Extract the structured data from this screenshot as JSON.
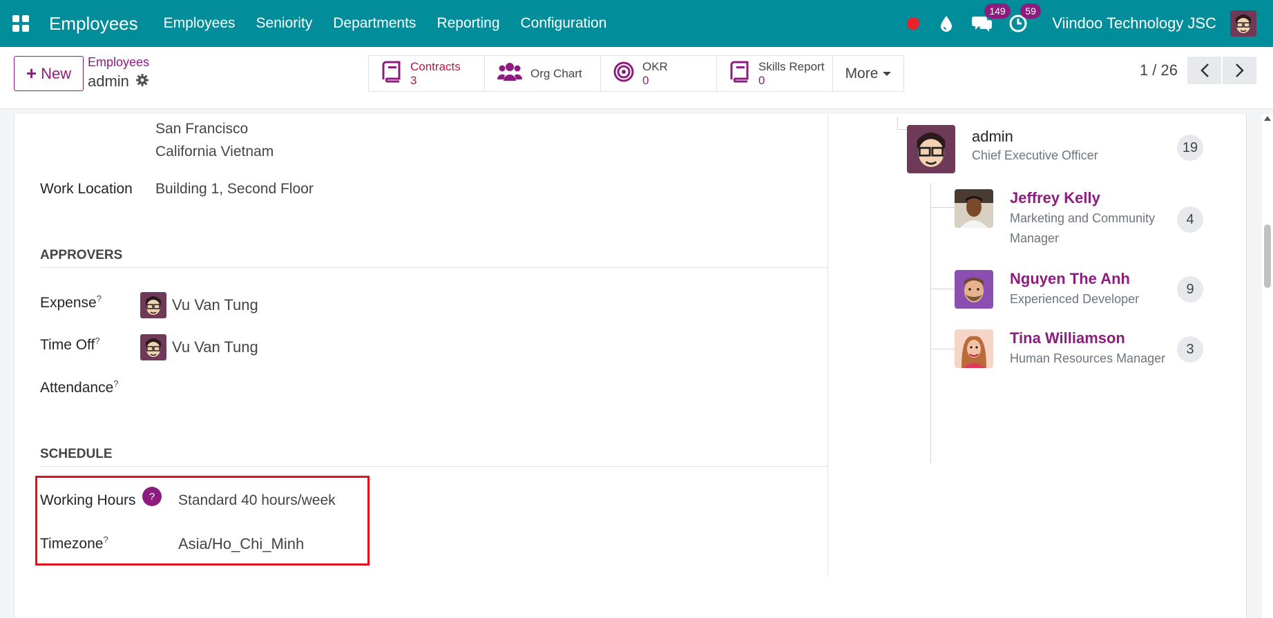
{
  "navbar": {
    "app_title": "Employees",
    "menu": [
      "Employees",
      "Seniority",
      "Departments",
      "Reporting",
      "Configuration"
    ],
    "messages_count": "149",
    "activities_count": "59",
    "company": "Viindoo Technology JSC",
    "colors": {
      "bar": "#018d9a",
      "badge": "#8c1c7d",
      "record": "#e8212b"
    }
  },
  "control": {
    "new_label": "New",
    "breadcrumb_parent": "Employees",
    "breadcrumb_current": "admin",
    "smart_buttons": [
      {
        "label": "Contracts",
        "value": "3",
        "icon": "book-icon"
      },
      {
        "label": "Org Chart",
        "value": "",
        "icon": "users-icon"
      },
      {
        "label": "OKR",
        "value": "0",
        "icon": "target-icon"
      },
      {
        "label": "Skills Report",
        "value": "0",
        "icon": "book-icon"
      }
    ],
    "more_label": "More",
    "pager": "1 / 26"
  },
  "form": {
    "address_line1": "San Francisco",
    "address_line2": "California Vietnam",
    "work_location_label": "Work Location",
    "work_location_value": "Building 1, Second Floor",
    "approvers_title": "APPROVERS",
    "expense_label": "Expense",
    "expense_value": "Vu Van Tung",
    "timeoff_label": "Time Off",
    "timeoff_value": "Vu Van Tung",
    "attendance_label": "Attendance",
    "help_mark": "?",
    "schedule_title": "SCHEDULE",
    "working_hours_label": "Working Hours",
    "working_hours_value": "Standard 40 hours/week",
    "timezone_label": "Timezone",
    "timezone_value": "Asia/Ho_Chi_Minh"
  },
  "org_chart": {
    "manager": {
      "name": "admin",
      "role": "Chief Executive Officer",
      "count": "19"
    },
    "subordinates": [
      {
        "name": "Jeffrey Kelly",
        "role_line1": "Marketing and Community",
        "role_line2": "Manager",
        "count": "4"
      },
      {
        "name": "Nguyen The Anh",
        "role_line1": "Experienced Developer",
        "role_line2": "",
        "count": "9"
      },
      {
        "name": "Tina Williamson",
        "role_line1": "Human Resources Manager",
        "role_line2": "",
        "count": "3"
      }
    ]
  }
}
